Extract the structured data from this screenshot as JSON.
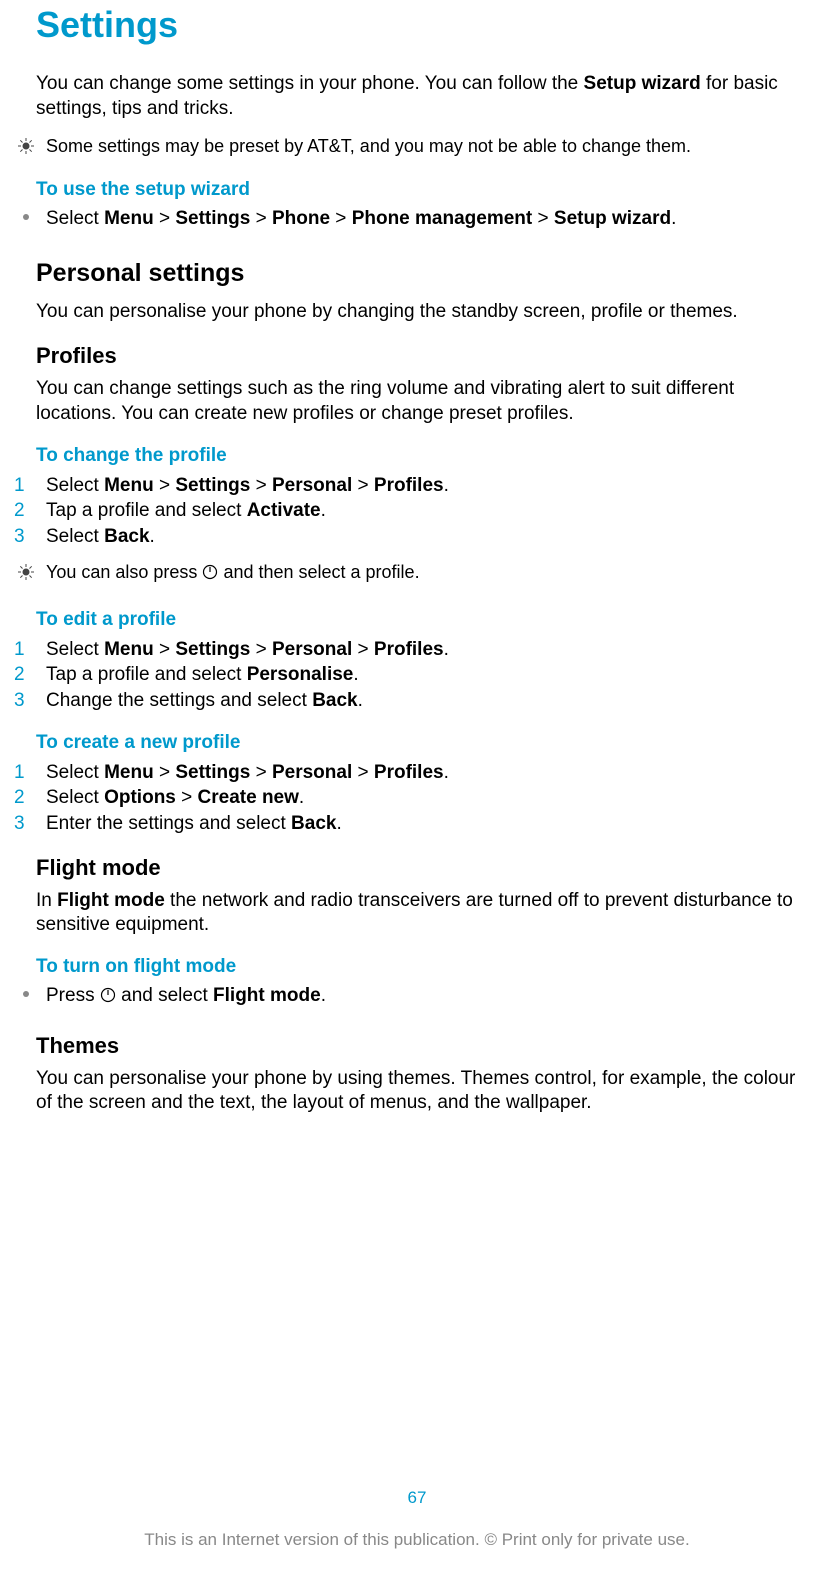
{
  "title": "Settings",
  "intro_parts": [
    "You can change some settings in your phone. You can follow the ",
    "Setup wizard",
    " for basic settings, tips and tricks."
  ],
  "tip1": "Some settings may be preset by AT&T, and you may not be able to change them.",
  "setup_wizard_head": "To use the setup wizard",
  "setup_wizard_step_parts": [
    "Select ",
    "Menu",
    " > ",
    "Settings",
    " > ",
    "Phone",
    " > ",
    "Phone management",
    " > ",
    "Setup wizard",
    "."
  ],
  "personal_settings_head": "Personal settings",
  "personal_settings_body": "You can personalise your phone by changing the standby screen, profile or themes.",
  "profiles_head": "Profiles",
  "profiles_body": "You can change settings such as the ring volume and vibrating alert to suit different locations. You can create new profiles or change preset profiles.",
  "change_profile_head": "To change the profile",
  "change_profile_steps": [
    [
      "Select ",
      "Menu",
      " > ",
      "Settings",
      " > ",
      "Personal",
      " > ",
      "Profiles",
      "."
    ],
    [
      "Tap a profile and select ",
      "Activate",
      "."
    ],
    [
      "Select ",
      "Back",
      "."
    ]
  ],
  "tip2_parts": [
    "You can also press ",
    "POWER_ICON",
    " and then select a profile."
  ],
  "edit_profile_head": "To edit a profile",
  "edit_profile_steps": [
    [
      "Select ",
      "Menu",
      " > ",
      "Settings",
      " > ",
      "Personal",
      " > ",
      "Profiles",
      "."
    ],
    [
      "Tap a profile and select ",
      "Personalise",
      "."
    ],
    [
      "Change the settings and select ",
      "Back",
      "."
    ]
  ],
  "create_profile_head": "To create a new profile",
  "create_profile_steps": [
    [
      "Select ",
      "Menu",
      " > ",
      "Settings",
      " > ",
      "Personal",
      " > ",
      "Profiles",
      "."
    ],
    [
      "Select ",
      "Options",
      " > ",
      "Create new",
      "."
    ],
    [
      "Enter the settings and select ",
      "Back",
      "."
    ]
  ],
  "flight_mode_head": "Flight mode",
  "flight_mode_body_parts": [
    "In ",
    "Flight mode",
    " the network and radio transceivers are turned off to prevent disturbance to sensitive equipment."
  ],
  "flight_mode_turn_on_head": "To turn on flight mode",
  "flight_mode_step_parts": [
    "Press ",
    "POWER_ICON",
    " and select ",
    "Flight mode",
    "."
  ],
  "themes_head": "Themes",
  "themes_body": "You can personalise your phone by using themes. Themes control, for example, the colour of the screen and the text, the layout of menus, and the wallpaper.",
  "page_number": "67",
  "footer_text": "This is an Internet version of this publication. © Print only for private use."
}
